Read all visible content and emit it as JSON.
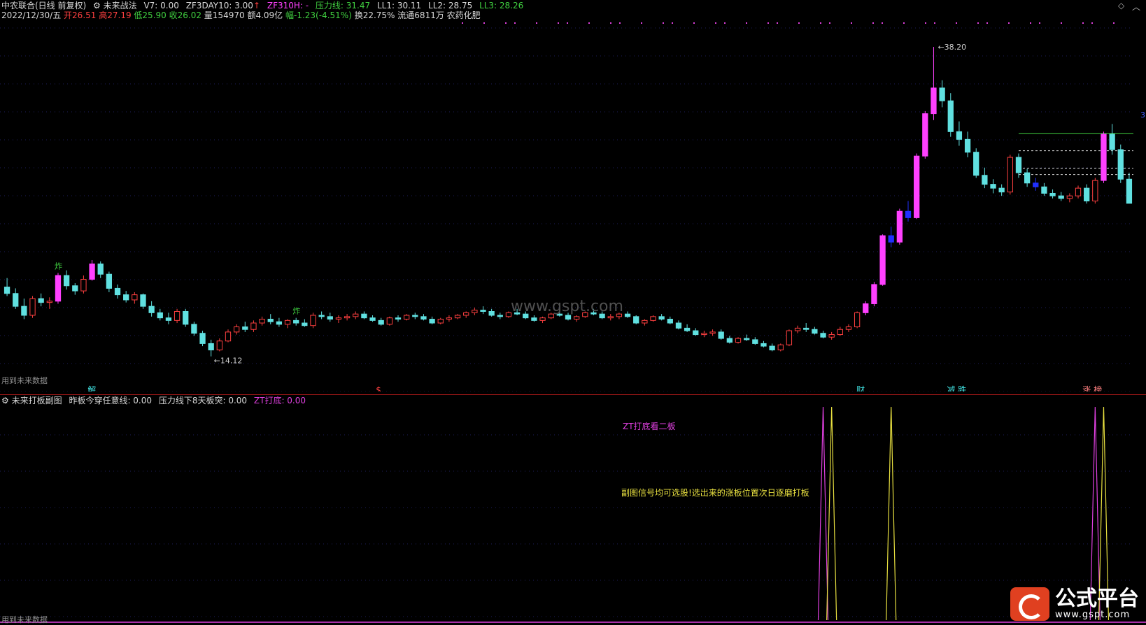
{
  "header": {
    "stock_name": "中农联合(日线 前复权)",
    "formula_name": "未来战法",
    "v7": "V7: 0.00",
    "zf3day": "ZF3DAY10: 3.00",
    "zf310h": "ZF310H: -",
    "pressure": "压力线: 31.47",
    "ll1": "LL1: 30.11",
    "ll2": "LL2: 28.75",
    "ll3": "LL3: 28.26"
  },
  "quote": {
    "date": "2022/12/30/五",
    "open": "开26.51",
    "high": "高27.19",
    "low": "低25.90",
    "close": "收26.02",
    "volume": "量154970",
    "amount": "额4.09亿",
    "change": "幅-1.23(-4.51%)",
    "turnover": "换22.75%",
    "float": "流通6811万",
    "sector": "农药化肥"
  },
  "main_chart": {
    "future_data_note": "用到未来数据",
    "high_label": "38.20",
    "low_label": "14.12",
    "watermark": "www.gspt.com",
    "right_axis_mark": "3",
    "bottom_markers": [
      {
        "label": "解",
        "color": "#40e0e0"
      },
      {
        "label": "$",
        "color": "#ff4040"
      },
      {
        "label": "财",
        "color": "#40e0e0"
      },
      {
        "label": "减 跌",
        "color": "#40e0e0"
      },
      {
        "label": "涨 榜",
        "color": "#ff8080"
      }
    ],
    "bottom_marker_pos": [
      0.075,
      0.33,
      0.755,
      0.835,
      0.955
    ],
    "zha_label": "炸"
  },
  "sub_chart": {
    "title": "未来打板副图",
    "field1": "昨板今穿任意线: 0.00",
    "field2": "压力线下8天板突: 0.00",
    "field3": "ZT打底: 0.00",
    "note1": "ZT打底看二板",
    "note2": "副图信号均可选股!选出来的涨板位置次日逐磨打板",
    "future_data_note": "用到未来数据"
  },
  "logo": {
    "text": "公式平台",
    "url": "www.gspt.com"
  },
  "chart_data": {
    "type": "candlestick",
    "title": "中农联合(日线 前复权)",
    "ylim": [
      13,
      40
    ],
    "high_mark": 38.2,
    "low_mark": 14.12,
    "candles": [
      [
        19.5,
        20.2,
        18.8,
        19.0
      ],
      [
        19.0,
        19.4,
        17.8,
        18.0
      ],
      [
        18.0,
        18.6,
        17.0,
        17.3
      ],
      [
        17.3,
        18.8,
        17.1,
        18.6
      ],
      [
        18.6,
        19.0,
        18.0,
        18.3
      ],
      [
        18.3,
        18.7,
        17.8,
        18.4
      ],
      [
        18.4,
        20.6,
        18.2,
        20.4
      ],
      [
        20.4,
        20.8,
        19.3,
        19.6
      ],
      [
        19.6,
        19.8,
        18.9,
        19.2
      ],
      [
        19.2,
        20.4,
        19.0,
        20.1
      ],
      [
        20.1,
        21.6,
        20.0,
        21.3
      ],
      [
        21.3,
        21.5,
        20.2,
        20.5
      ],
      [
        20.5,
        20.7,
        19.1,
        19.4
      ],
      [
        19.4,
        19.7,
        18.6,
        18.9
      ],
      [
        18.9,
        19.2,
        18.3,
        18.5
      ],
      [
        18.5,
        19.1,
        18.2,
        18.9
      ],
      [
        18.9,
        19.0,
        17.8,
        18.0
      ],
      [
        18.0,
        18.4,
        17.2,
        17.5
      ],
      [
        17.5,
        17.8,
        16.9,
        17.1
      ],
      [
        17.1,
        17.5,
        16.6,
        16.9
      ],
      [
        16.9,
        17.8,
        16.7,
        17.6
      ],
      [
        17.6,
        17.8,
        16.4,
        16.6
      ],
      [
        16.6,
        16.8,
        15.7,
        15.9
      ],
      [
        15.9,
        16.1,
        14.9,
        15.1
      ],
      [
        15.1,
        15.4,
        14.1,
        14.6
      ],
      [
        14.6,
        15.5,
        14.5,
        15.3
      ],
      [
        15.3,
        16.2,
        15.2,
        16.0
      ],
      [
        16.0,
        16.6,
        15.8,
        16.4
      ],
      [
        16.4,
        16.8,
        16.0,
        16.2
      ],
      [
        16.2,
        16.9,
        16.0,
        16.7
      ],
      [
        16.7,
        17.2,
        16.5,
        17.0
      ],
      [
        17.0,
        17.4,
        16.6,
        16.8
      ],
      [
        16.8,
        17.1,
        16.4,
        16.6
      ],
      [
        16.6,
        17.0,
        16.3,
        16.9
      ],
      [
        16.9,
        17.1,
        16.5,
        16.7
      ],
      [
        16.7,
        17.0,
        16.4,
        16.5
      ],
      [
        16.5,
        17.5,
        16.3,
        17.3
      ],
      [
        17.3,
        17.6,
        17.0,
        17.2
      ],
      [
        17.2,
        17.5,
        16.8,
        17.0
      ],
      [
        17.0,
        17.3,
        16.7,
        17.1
      ],
      [
        17.1,
        17.4,
        16.9,
        17.2
      ],
      [
        17.2,
        17.6,
        17.0,
        17.4
      ],
      [
        17.4,
        17.6,
        17.0,
        17.1
      ],
      [
        17.1,
        17.3,
        16.8,
        16.9
      ],
      [
        16.9,
        17.1,
        16.5,
        16.6
      ],
      [
        16.6,
        17.2,
        16.5,
        17.1
      ],
      [
        17.1,
        17.3,
        16.8,
        17.0
      ],
      [
        17.0,
        17.4,
        16.9,
        17.3
      ],
      [
        17.3,
        17.5,
        17.0,
        17.2
      ],
      [
        17.2,
        17.4,
        16.9,
        17.0
      ],
      [
        17.0,
        17.2,
        16.6,
        16.7
      ],
      [
        16.7,
        17.1,
        16.6,
        17.0
      ],
      [
        17.0,
        17.3,
        16.8,
        17.1
      ],
      [
        17.1,
        17.4,
        17.0,
        17.3
      ],
      [
        17.3,
        17.6,
        17.1,
        17.5
      ],
      [
        17.5,
        17.9,
        17.3,
        17.7
      ],
      [
        17.7,
        18.0,
        17.4,
        17.6
      ],
      [
        17.6,
        17.8,
        17.2,
        17.3
      ],
      [
        17.3,
        17.5,
        17.0,
        17.2
      ],
      [
        17.2,
        17.6,
        17.1,
        17.5
      ],
      [
        17.5,
        17.8,
        17.3,
        17.4
      ],
      [
        17.4,
        17.6,
        17.0,
        17.1
      ],
      [
        17.1,
        17.3,
        16.8,
        16.9
      ],
      [
        16.9,
        17.2,
        16.7,
        17.1
      ],
      [
        17.1,
        17.5,
        17.0,
        17.4
      ],
      [
        17.4,
        17.7,
        17.2,
        17.3
      ],
      [
        17.3,
        17.5,
        16.9,
        17.0
      ],
      [
        17.0,
        17.3,
        16.8,
        17.2
      ],
      [
        17.2,
        17.6,
        17.1,
        17.5
      ],
      [
        17.5,
        17.8,
        17.3,
        17.4
      ],
      [
        17.4,
        17.6,
        17.0,
        17.1
      ],
      [
        17.1,
        17.4,
        16.9,
        17.2
      ],
      [
        17.2,
        17.5,
        17.0,
        17.4
      ],
      [
        17.4,
        17.6,
        17.1,
        17.2
      ],
      [
        17.2,
        17.3,
        16.6,
        16.7
      ],
      [
        16.7,
        17.0,
        16.5,
        16.9
      ],
      [
        16.9,
        17.3,
        16.8,
        17.2
      ],
      [
        17.2,
        17.4,
        16.9,
        17.0
      ],
      [
        17.0,
        17.2,
        16.6,
        16.7
      ],
      [
        16.7,
        16.9,
        16.2,
        16.3
      ],
      [
        16.3,
        16.6,
        16.0,
        16.1
      ],
      [
        16.1,
        16.3,
        15.7,
        15.8
      ],
      [
        15.8,
        16.1,
        15.6,
        15.9
      ],
      [
        15.9,
        16.2,
        15.7,
        16.0
      ],
      [
        16.0,
        16.2,
        15.4,
        15.5
      ],
      [
        15.5,
        15.7,
        15.1,
        15.2
      ],
      [
        15.2,
        15.6,
        15.1,
        15.5
      ],
      [
        15.5,
        15.8,
        15.3,
        15.4
      ],
      [
        15.4,
        15.6,
        15.0,
        15.1
      ],
      [
        15.1,
        15.3,
        14.8,
        14.9
      ],
      [
        14.9,
        15.1,
        14.5,
        14.6
      ],
      [
        14.6,
        15.1,
        14.5,
        15.0
      ],
      [
        15.0,
        16.2,
        14.9,
        16.1
      ],
      [
        16.1,
        16.5,
        15.9,
        16.3
      ],
      [
        16.3,
        16.7,
        16.0,
        16.2
      ],
      [
        16.2,
        16.4,
        15.8,
        15.9
      ],
      [
        15.9,
        16.1,
        15.5,
        15.6
      ],
      [
        15.6,
        16.0,
        15.4,
        15.8
      ],
      [
        15.8,
        16.4,
        15.7,
        16.2
      ],
      [
        16.2,
        16.6,
        16.0,
        16.4
      ],
      [
        16.4,
        17.6,
        16.3,
        17.5
      ],
      [
        17.5,
        18.4,
        17.3,
        18.2
      ],
      [
        18.2,
        19.9,
        18.0,
        19.7
      ],
      [
        19.7,
        23.6,
        19.6,
        23.5
      ],
      [
        23.5,
        24.2,
        22.6,
        23.0
      ],
      [
        23.0,
        25.6,
        22.8,
        25.4
      ],
      [
        25.4,
        26.2,
        24.6,
        24.9
      ],
      [
        24.9,
        29.9,
        24.8,
        29.7
      ],
      [
        29.7,
        33.2,
        29.5,
        33.0
      ],
      [
        33.0,
        38.2,
        32.5,
        35.0
      ],
      [
        35.0,
        35.6,
        33.5,
        34.0
      ],
      [
        34.0,
        34.6,
        31.2,
        31.6
      ],
      [
        31.6,
        32.4,
        30.5,
        31.0
      ],
      [
        31.0,
        31.6,
        29.6,
        30.0
      ],
      [
        30.0,
        30.3,
        28.0,
        28.2
      ],
      [
        28.2,
        28.8,
        27.2,
        27.5
      ],
      [
        27.5,
        27.9,
        26.8,
        27.2
      ],
      [
        27.2,
        27.5,
        26.6,
        26.9
      ],
      [
        26.9,
        29.8,
        26.7,
        29.6
      ],
      [
        29.6,
        29.9,
        28.0,
        28.4
      ],
      [
        28.4,
        28.7,
        27.3,
        27.6
      ],
      [
        27.6,
        28.0,
        27.0,
        27.3
      ],
      [
        27.3,
        27.6,
        26.6,
        26.8
      ],
      [
        26.8,
        27.1,
        26.4,
        26.6
      ],
      [
        26.6,
        26.9,
        26.2,
        26.4
      ],
      [
        26.4,
        26.8,
        26.1,
        26.6
      ],
      [
        26.6,
        27.4,
        26.4,
        27.2
      ],
      [
        27.2,
        27.5,
        26.0,
        26.2
      ],
      [
        26.2,
        28.0,
        26.0,
        27.8
      ],
      [
        27.8,
        31.6,
        27.6,
        31.4
      ],
      [
        31.4,
        32.2,
        29.8,
        30.2
      ],
      [
        30.2,
        30.6,
        27.6,
        27.9
      ],
      [
        27.9,
        28.4,
        26.6,
        26.02
      ]
    ],
    "limit_up_indices": [
      6,
      10,
      101,
      102,
      103,
      104,
      105,
      106,
      107,
      108,
      109,
      121,
      129
    ],
    "levels": [
      {
        "name": "压力线",
        "value": 31.47
      },
      {
        "name": "LL1",
        "value": 30.11
      },
      {
        "name": "LL2",
        "value": 28.75
      },
      {
        "name": "LL3",
        "value": 28.26
      }
    ],
    "sub_spikes": [
      {
        "index": 96,
        "color": "#e040e0"
      },
      {
        "index": 97,
        "color": "#e8e040"
      },
      {
        "index": 104,
        "color": "#e8e040"
      },
      {
        "index": 128,
        "color": "#e040e0"
      },
      {
        "index": 129,
        "color": "#e8e040"
      }
    ]
  }
}
